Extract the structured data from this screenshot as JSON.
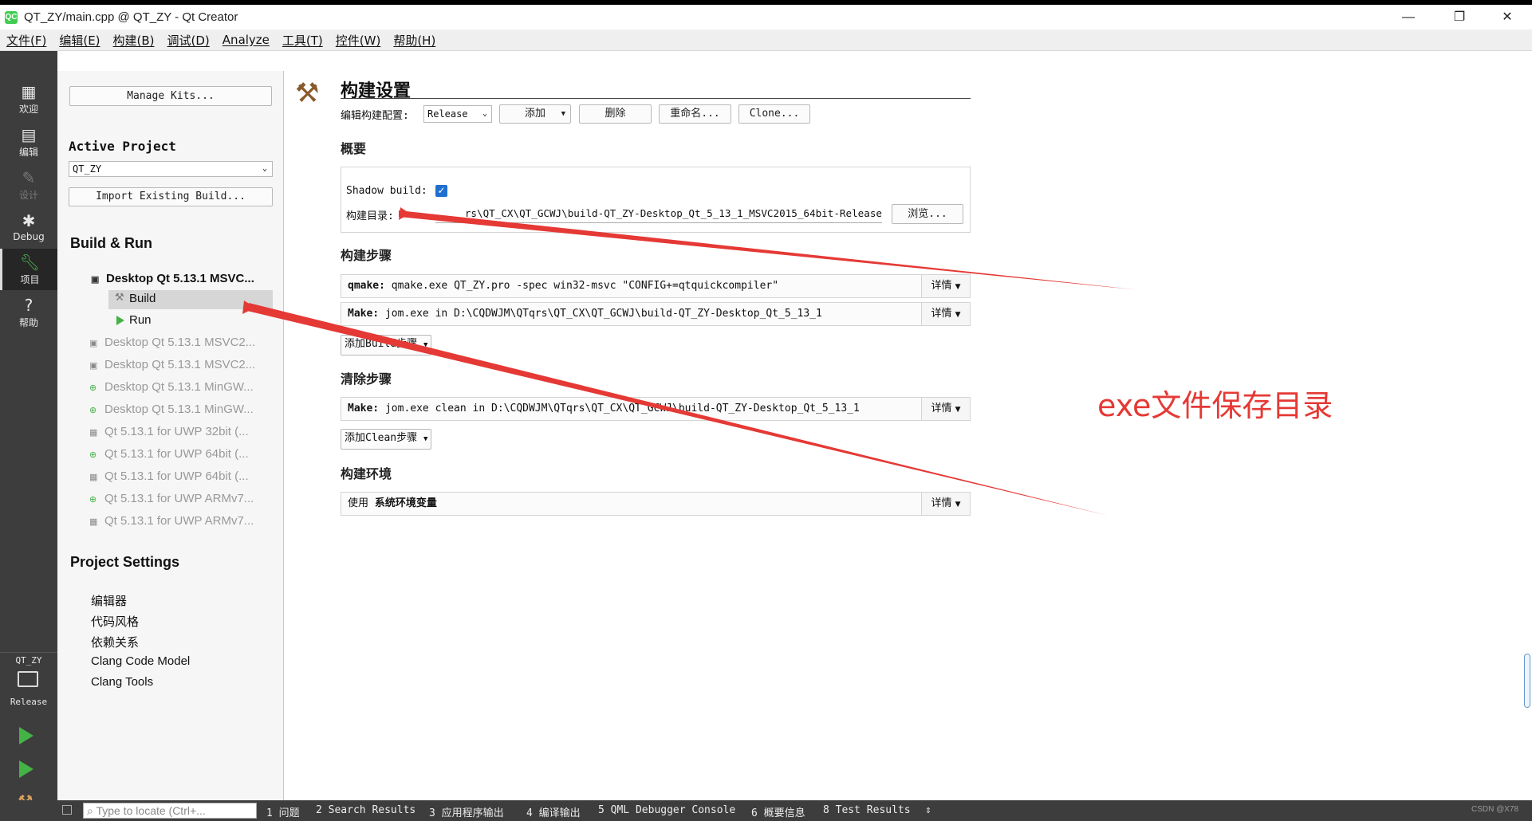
{
  "window": {
    "title": "QT_ZY/main.cpp @ QT_ZY - Qt Creator",
    "app_icon": "QC",
    "controls": [
      "—",
      "❐",
      "✕"
    ]
  },
  "menu": [
    {
      "label": "文件(F)"
    },
    {
      "label": "编辑(E)"
    },
    {
      "label": "构建(B)"
    },
    {
      "label": "调试(D)"
    },
    {
      "label": "Analyze"
    },
    {
      "label": "工具(T)"
    },
    {
      "label": "控件(W)"
    },
    {
      "label": "帮助(H)"
    }
  ],
  "modes": [
    {
      "label": "欢迎",
      "icon": "grid-icon"
    },
    {
      "label": "编辑",
      "icon": "document-icon"
    },
    {
      "label": "设计",
      "icon": "pencil-icon"
    },
    {
      "label": "Debug",
      "icon": "bug-icon"
    },
    {
      "label": "项目",
      "icon": "wrench-icon"
    },
    {
      "label": "帮助",
      "icon": "help-icon"
    }
  ],
  "target": {
    "project": "QT_ZY",
    "config": "Release"
  },
  "left": {
    "manage_kits": "Manage Kits...",
    "active_project_label": "Active Project",
    "project_combo": "QT_ZY",
    "import_button": "Import Existing Build...",
    "build_run_label": "Build & Run",
    "active_kit": "Desktop Qt 5.13.1 MSVC...",
    "build_label": "Build",
    "run_label": "Run",
    "kits": [
      "Desktop Qt 5.13.1 MSVC2...",
      "Desktop Qt 5.13.1 MSVC2...",
      "Desktop Qt 5.13.1 MinGW...",
      "Desktop Qt 5.13.1 MinGW...",
      "Qt 5.13.1 for UWP 32bit (...",
      "Qt 5.13.1 for UWP 64bit (...",
      "Qt 5.13.1 for UWP 64bit (...",
      "Qt 5.13.1 for UWP ARMv7...",
      "Qt 5.13.1 for UWP ARMv7..."
    ],
    "project_settings_label": "Project Settings",
    "project_settings": [
      "编辑器",
      "代码风格",
      "依赖关系",
      "Clang Code Model",
      "Clang Tools"
    ]
  },
  "main": {
    "title": "构建设置",
    "edit_config_label": "编辑构建配置:",
    "config_value": "Release",
    "add_button": "添加",
    "delete_button": "删除",
    "rename_button": "重命名...",
    "clone_button": "Clone...",
    "overview_label": "概要",
    "shadow_build_label": "Shadow build:",
    "shadow_build_checked": true,
    "build_dir_label": "构建目录:",
    "build_dir_value": "rs\\QT_CX\\QT_GCWJ\\build-QT_ZY-Desktop_Qt_5_13_1_MSVC2015_64bit-Release",
    "browse_button": "浏览...",
    "build_steps_label": "构建步骤",
    "build_steps": [
      {
        "name": "qmake:",
        "cmd": "qmake.exe QT_ZY.pro -spec win32-msvc \"CONFIG+=qtquickcompiler\""
      },
      {
        "name": "Make:",
        "cmd": "jom.exe in D:\\CQDWJM\\QTqrs\\QT_CX\\QT_GCWJ\\build-QT_ZY-Desktop_Qt_5_13_1"
      }
    ],
    "detail_label": "详情",
    "add_build_step": "添加Build步骤",
    "clean_steps_label": "清除步骤",
    "clean_steps": [
      {
        "name": "Make:",
        "cmd": "jom.exe clean in D:\\CQDWJM\\QTqrs\\QT_CX\\QT_GCWJ\\build-QT_ZY-Desktop_Qt_5_13_1"
      }
    ],
    "add_clean_step": "添加Clean步骤",
    "build_env_label": "构建环境",
    "env_use": "使用",
    "env_value": "系统环境变量"
  },
  "annotation": {
    "text": "exe文件保存目录",
    "color": "#e53935"
  },
  "status": {
    "locator_placeholder": "Type to locate (Ctrl+...",
    "tabs": [
      "1 问题",
      "2 Search Results",
      "3 应用程序输出",
      "4 编译输出",
      "5 QML Debugger Console",
      "6 概要信息",
      "8 Test Results"
    ],
    "watermark": "CSDN @X78"
  }
}
